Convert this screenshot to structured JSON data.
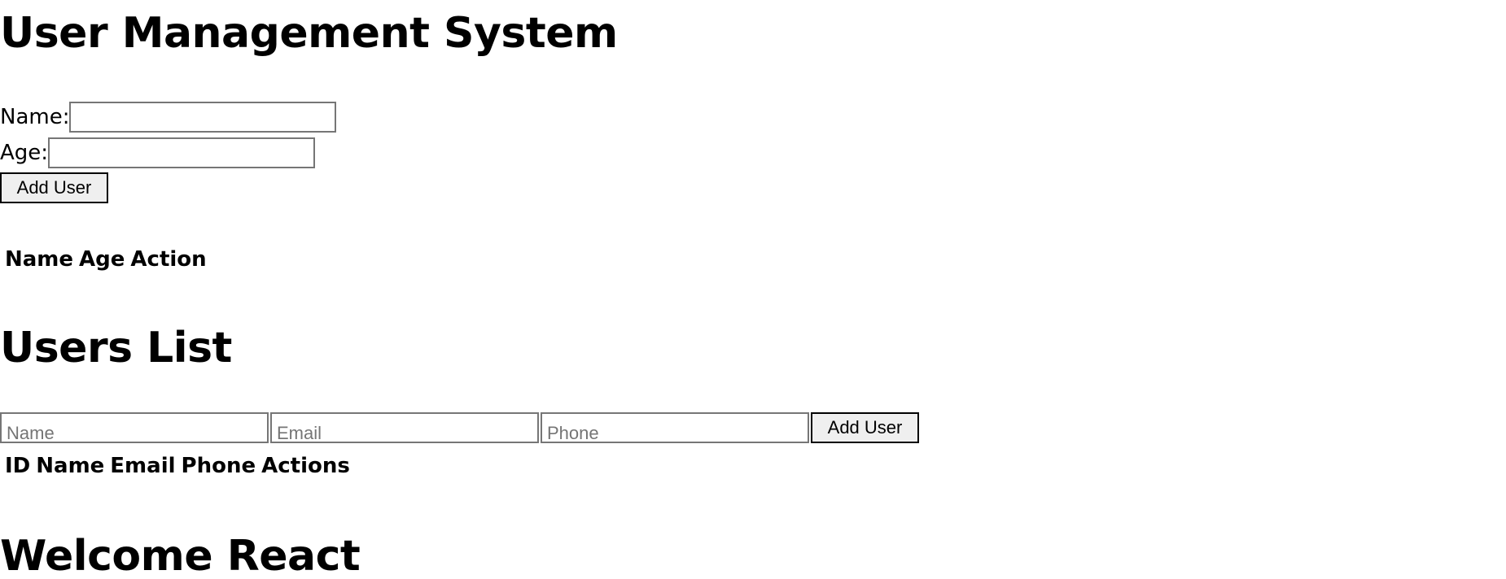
{
  "headings": {
    "main": "User Management System",
    "users_list": "Users List",
    "welcome": "Welcome React"
  },
  "user_form": {
    "name_label": "Name:",
    "name_value": "",
    "age_label": "Age:",
    "age_value": "",
    "add_button": "Add User"
  },
  "user_table": {
    "columns": [
      "Name",
      "Age",
      "Action"
    ]
  },
  "users_list_form": {
    "name_placeholder": "Name",
    "email_placeholder": "Email",
    "phone_placeholder": "Phone",
    "add_button": "Add User"
  },
  "users_list_table": {
    "columns": [
      "ID",
      "Name",
      "Email",
      "Phone",
      "Actions"
    ]
  }
}
